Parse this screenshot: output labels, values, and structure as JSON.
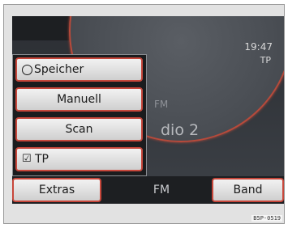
{
  "display": {
    "time": "19:47",
    "tp_indicator": "TP",
    "band": "FM",
    "station": "dio 2"
  },
  "menu": {
    "items": [
      {
        "label": "Speicher",
        "icon": "radio-circle-icon"
      },
      {
        "label": "Manuell"
      },
      {
        "label": "Scan"
      },
      {
        "label": "TP",
        "icon": "checkmark-icon"
      }
    ]
  },
  "bottom": {
    "left_button": "Extras",
    "middle_label": "FM",
    "right_button": "Band"
  },
  "figure_code": "B5P-0519",
  "colors": {
    "accent": "#c8473b",
    "screen": "#2b2e33"
  }
}
